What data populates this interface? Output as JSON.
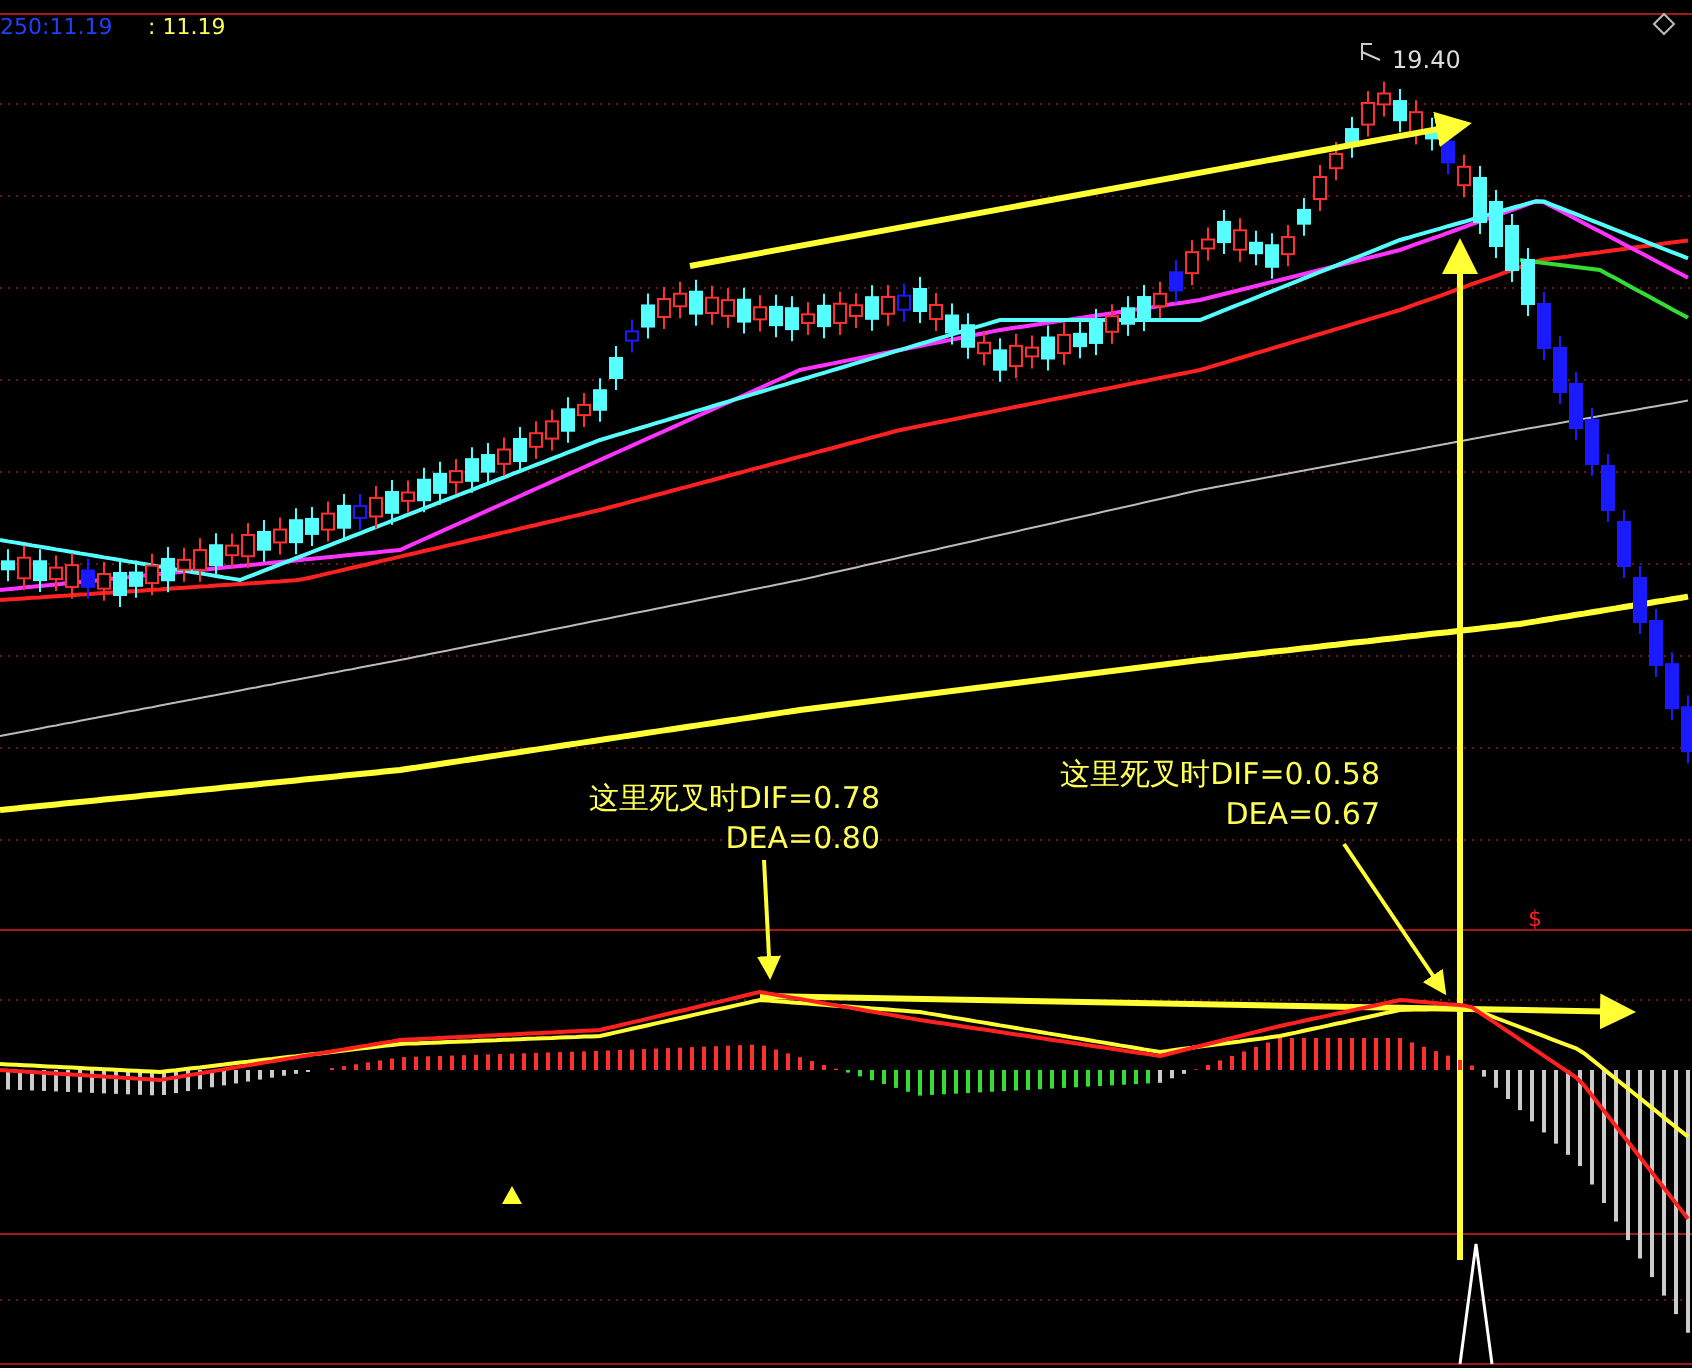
{
  "header": {
    "indicator_label": "250:11.19",
    "value_label": ": 11.19"
  },
  "price_chart": {
    "high_label": "19.40"
  },
  "annotations": [
    {
      "lines": [
        "这里死叉时DIF=0.78",
        "DEA=0.80"
      ]
    },
    {
      "lines": [
        "这里死叉时DIF=0.0.58",
        "DEA=0.67"
      ]
    }
  ],
  "macd_panel": {
    "signal_mark": "$"
  }
}
